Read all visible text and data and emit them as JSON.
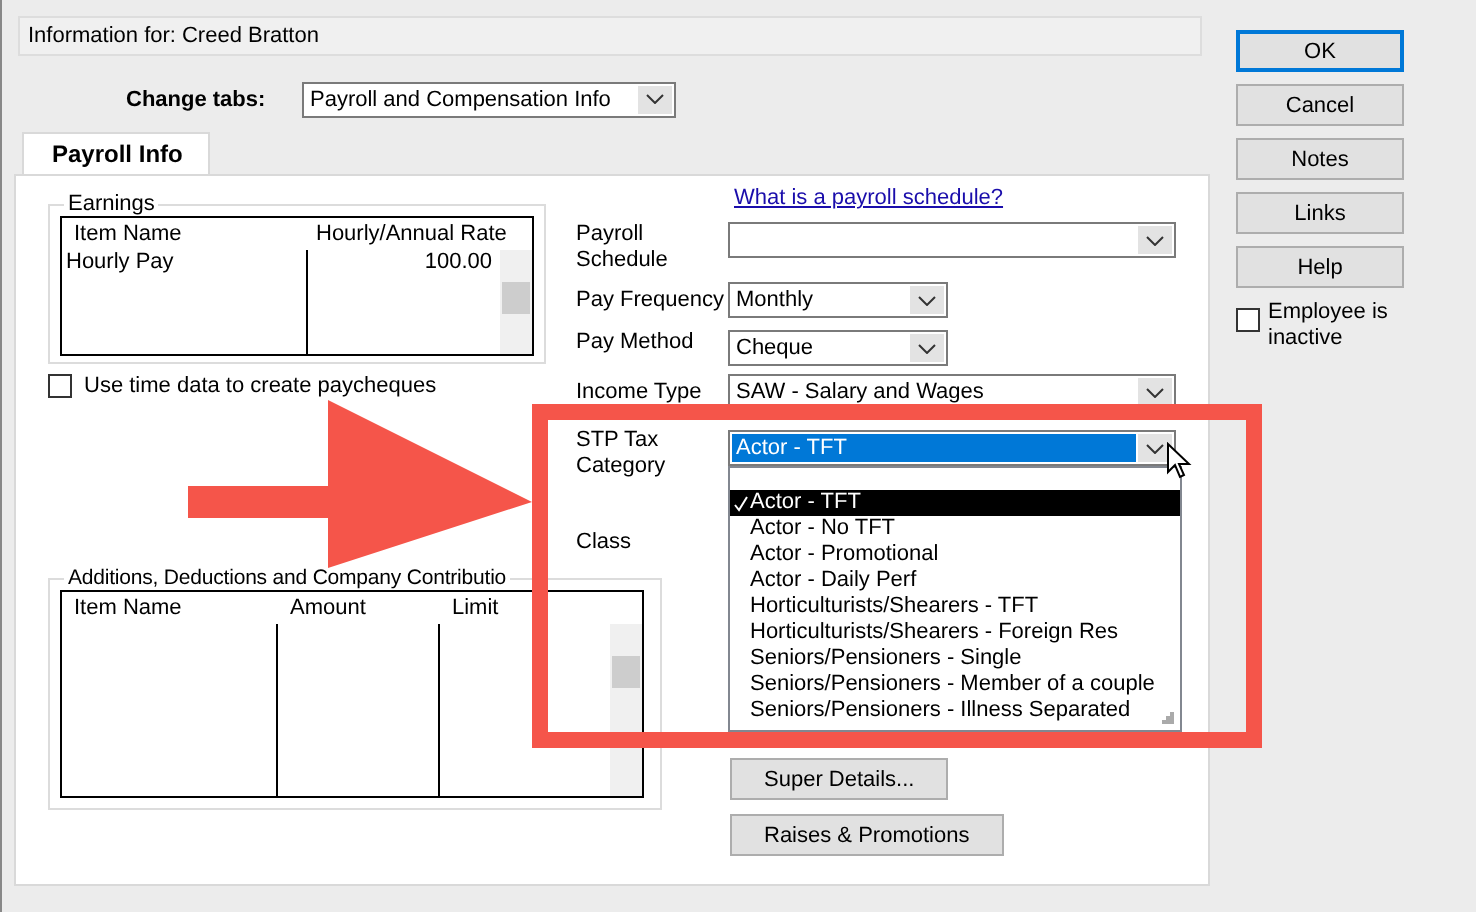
{
  "header": {
    "label": "Information for:",
    "name": "Creed Bratton"
  },
  "change_tabs": {
    "label": "Change tabs:",
    "value": "Payroll and Compensation Info"
  },
  "tabs": [
    {
      "label": "Payroll Info",
      "selected": true
    }
  ],
  "earnings": {
    "title": "Earnings",
    "columns": [
      "Item Name",
      "Hourly/Annual Rate"
    ],
    "rows": [
      [
        "Hourly Pay",
        "100.00"
      ]
    ]
  },
  "time_data": {
    "label": "Use time data to create paycheques",
    "checked": false
  },
  "payroll_link": "What is a payroll schedule?",
  "fields": [
    {
      "label": "Payroll Schedule",
      "kind": "long",
      "focused": false
    },
    {
      "label": "Pay Frequency",
      "value": "Monthly",
      "kind": "short",
      "focused": false
    },
    {
      "label": "Pay Method",
      "value": "Cheque",
      "kind": "short",
      "focused": false
    },
    {
      "label": "Income Type",
      "value": "SAW - Salary and Wages",
      "kind": "long",
      "focused": false
    },
    {
      "label": "STP Tax Category",
      "value": "Actor - TFT",
      "kind": "long",
      "focused": true
    }
  ],
  "class_label": "Class",
  "dropdown": {
    "options": [
      {
        "label": "Actor - TFT",
        "selected": true
      },
      {
        "label": "Actor - No TFT",
        "selected": false
      },
      {
        "label": "Actor - Promotional",
        "selected": false
      },
      {
        "label": "Actor - Daily Perf",
        "selected": false
      },
      {
        "label": "Horticulturists/Shearers - TFT",
        "selected": false
      },
      {
        "label": "Horticulturists/Shearers - Foreign Res",
        "selected": false
      },
      {
        "label": "Seniors/Pensioners - Single",
        "selected": false
      },
      {
        "label": "Seniors/Pensioners - Member of a couple",
        "selected": false
      },
      {
        "label": "Seniors/Pensioners - Illness Separated",
        "selected": false
      }
    ]
  },
  "additions": {
    "title": "Additions, Deductions and Company Contributio",
    "columns": [
      "Item Name",
      "Amount",
      "Limit"
    ]
  },
  "panel_buttons": [
    "Super Details...",
    "Raises & Promotions"
  ],
  "side_buttons": [
    {
      "label": "OK",
      "default": true
    },
    {
      "label": "Cancel",
      "default": false
    },
    {
      "label": "Notes",
      "default": false
    },
    {
      "label": "Links",
      "default": false
    },
    {
      "label": "Help",
      "default": false
    }
  ],
  "inactive": {
    "label": "Employee is inactive",
    "checked": false
  },
  "highlight_box": {
    "color": "#f5554a"
  },
  "arrow": {
    "color": "#f5554a"
  }
}
